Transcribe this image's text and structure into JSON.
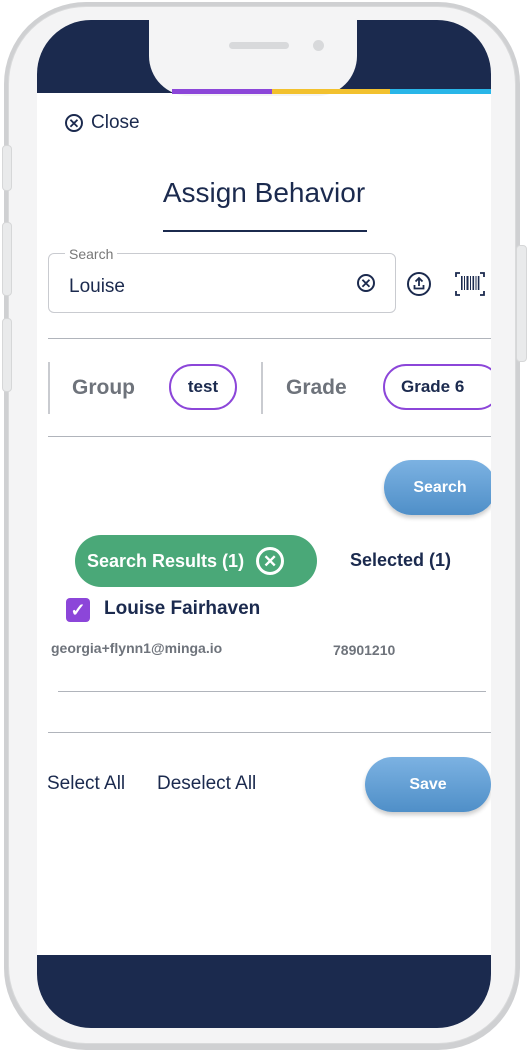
{
  "modal": {
    "close_label": "Close",
    "title": "Assign Behavior"
  },
  "search": {
    "label": "Search",
    "value": "Louise"
  },
  "filters": {
    "group_label": "Group",
    "group_value": "test",
    "grade_label": "Grade",
    "grade_value": "Grade 6"
  },
  "actions": {
    "search_button": "Search",
    "select_all": "Select All",
    "deselect_all": "Deselect All",
    "save_button": "Save"
  },
  "tabs": {
    "results": "Search Results (1)",
    "selected": "Selected (1)"
  },
  "results": [
    {
      "name": "Louise Fairhaven",
      "email": "georgia+flynn1@minga.io",
      "id": "78901210",
      "checked": true
    }
  ],
  "icons": {
    "close": "close-circle-icon",
    "clear": "clear-circle-icon",
    "upload": "upload-icon",
    "barcode": "barcode-icon"
  },
  "colors": {
    "navy": "#1b2a4e",
    "purple": "#8c46d9",
    "green": "#4aa878",
    "blue_button": "#5a9ad2",
    "stripe_purple": "#8c46d9",
    "stripe_yellow": "#f2c12e",
    "stripe_cyan": "#29b6e8"
  }
}
